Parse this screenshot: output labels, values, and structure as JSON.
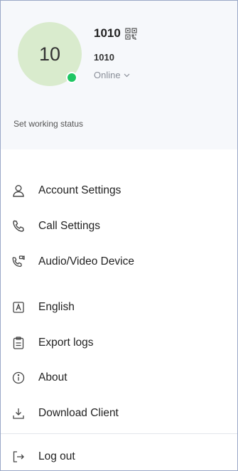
{
  "profile": {
    "avatar_text": "10",
    "name": "1010",
    "extension": "1010",
    "presence": "Online",
    "status_color": "#1ec663",
    "avatar_color": "#d9ebcd",
    "working_status_label": "Set working status"
  },
  "menu": {
    "account_settings": "Account Settings",
    "call_settings": "Call Settings",
    "audio_video_device": "Audio/Video Device",
    "language": "English",
    "export_logs": "Export logs",
    "about": "About",
    "download_client": "Download Client",
    "log_out": "Log out"
  },
  "icons": {
    "account_settings": "user-icon",
    "call_settings": "phone-icon",
    "audio_video_device": "phone-video-icon",
    "language": "language-icon",
    "export_logs": "clipboard-icon",
    "about": "info-icon",
    "download_client": "download-icon",
    "log_out": "logout-icon"
  }
}
